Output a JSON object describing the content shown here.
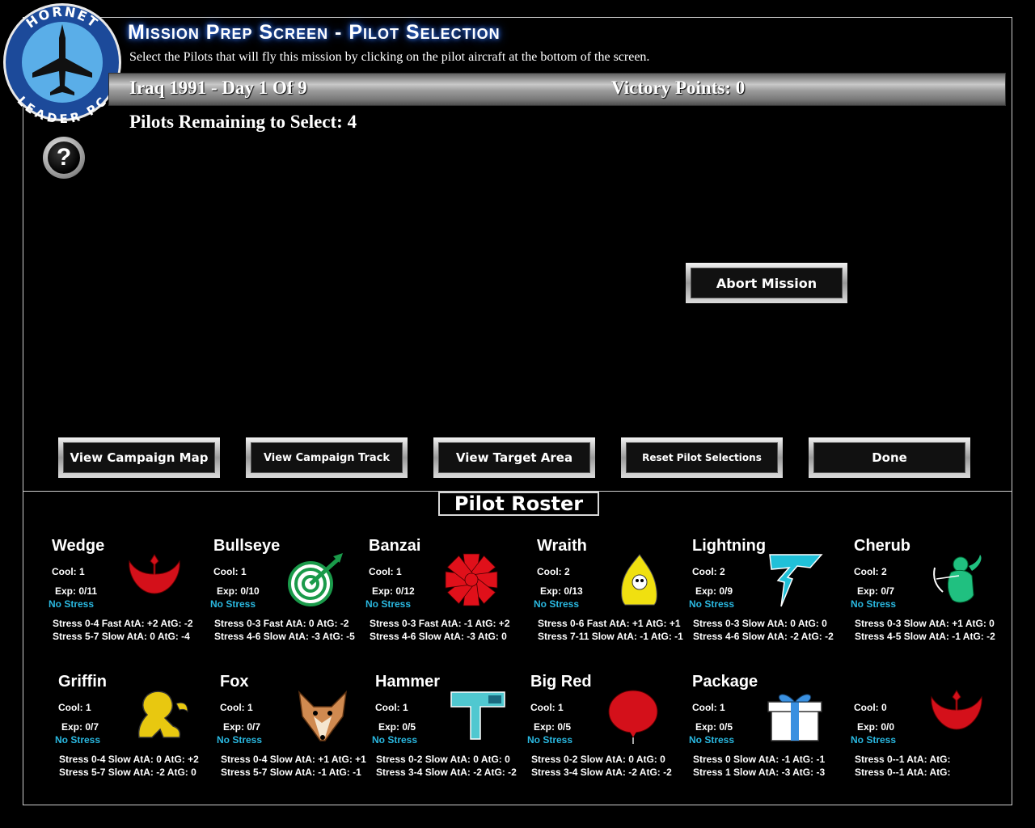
{
  "logo": {
    "top_text": "HORNET",
    "bottom_text": "LEADER PC"
  },
  "header": {
    "title": "Mission Prep Screen - Pilot Selection",
    "subtitle": "Select the Pilots that will fly this mission by clicking on the pilot aircraft at the bottom of the screen."
  },
  "banner": {
    "campaign": "Iraq 1991 - Day 1 Of 9",
    "victory_points": "Victory Points: 0"
  },
  "remaining": "Pilots Remaining to Select: 4",
  "help": {
    "label": "?"
  },
  "buttons": {
    "abort": "Abort Mission",
    "campaign_map": "View Campaign Map",
    "campaign_track": "View Campaign Track",
    "target_area": "View Target Area",
    "reset": "Reset Pilot Selections",
    "done": "Done"
  },
  "roster_title": "Pilot Roster",
  "pilots": [
    {
      "name": "Wedge",
      "cool": "Cool: 1",
      "exp": "Exp: 0/11",
      "stress": "No Stress",
      "line1": "Stress 0-4 Fast AtA: +2 AtG: -2",
      "line2": "Stress 5-7 Slow AtA: 0 AtG: -4",
      "icon": "red-anchor-icon",
      "color": "#d4101a"
    },
    {
      "name": "Bullseye",
      "cool": "Cool: 1",
      "exp": "Exp: 0/10",
      "stress": "No Stress",
      "line1": "Stress 0-3 Fast AtA: 0 AtG: -2",
      "line2": "Stress 4-6 Slow AtA: -3 AtG: -5",
      "icon": "bullseye-target-icon",
      "color": "#1a9a4a"
    },
    {
      "name": "Banzai",
      "cool": "Cool: 1",
      "exp": "Exp: 0/12",
      "stress": "No Stress",
      "line1": "Stress 0-3 Fast AtA: -1 AtG: +2",
      "line2": "Stress 4-6 Slow AtA: -3 AtG: 0",
      "icon": "rising-sun-burst-icon",
      "color": "#e0101a"
    },
    {
      "name": "Wraith",
      "cool": "Cool: 2",
      "exp": "Exp: 0/13",
      "stress": "No Stress",
      "line1": "Stress 0-6 Fast AtA: +1 AtG: +1",
      "line2": "Stress 7-11 Slow AtA: -1 AtG: -1",
      "icon": "yellow-ghost-icon",
      "color": "#f0e010"
    },
    {
      "name": "Lightning",
      "cool": "Cool: 2",
      "exp": "Exp: 0/9",
      "stress": "No Stress",
      "line1": "Stress 0-3 Slow AtA: 0 AtG: 0",
      "line2": "Stress 4-6 Slow AtA: -2 AtG: -2",
      "icon": "lightning-bolt-icon",
      "color": "#20c0d8"
    },
    {
      "name": "Cherub",
      "cool": "Cool: 2",
      "exp": "Exp: 0/7",
      "stress": "No Stress",
      "line1": "Stress 0-3 Slow AtA: +1 AtG: 0",
      "line2": "Stress 4-5 Slow AtA: -1 AtG: -2",
      "icon": "cherub-archer-icon",
      "color": "#20c080"
    },
    {
      "name": "Griffin",
      "cool": "Cool: 1",
      "exp": "Exp: 0/7",
      "stress": "No Stress",
      "line1": "Stress 0-4 Slow AtA: 0 AtG: +2",
      "line2": "Stress 5-7 Slow AtA: -2 AtG: 0",
      "icon": "griffin-lion-icon",
      "color": "#e8c810"
    },
    {
      "name": "Fox",
      "cool": "Cool: 1",
      "exp": "Exp: 0/7",
      "stress": "No Stress",
      "line1": "Stress 0-4 Slow AtA: +1 AtG: +1",
      "line2": "Stress 5-7 Slow AtA: -1 AtG: -1",
      "icon": "fox-head-icon",
      "color": "#d08a50"
    },
    {
      "name": "Hammer",
      "cool": "Cool: 1",
      "exp": "Exp: 0/5",
      "stress": "No Stress",
      "line1": "Stress 0-2 Slow AtA: 0 AtG: 0",
      "line2": "Stress 3-4 Slow AtA: -2 AtG: -2",
      "icon": "hammer-icon",
      "color": "#50c8d0"
    },
    {
      "name": "Big Red",
      "cool": "Cool: 1",
      "exp": "Exp: 0/5",
      "stress": "No Stress",
      "line1": "Stress 0-2 Slow AtA: 0 AtG: 0",
      "line2": "Stress 3-4 Slow AtA: -2 AtG: -2",
      "icon": "red-balloon-icon",
      "color": "#d4101a"
    },
    {
      "name": "Package",
      "cool": "Cool: 1",
      "exp": "Exp: 0/5",
      "stress": "No Stress",
      "line1": "Stress 0 Slow AtA: -1 AtG: -1",
      "line2": "Stress 1 Slow AtA: -3 AtG: -3",
      "icon": "gift-package-icon",
      "color": "#3a90e0"
    },
    {
      "name": "",
      "cool": "Cool: 0",
      "exp": "Exp: 0/0",
      "stress": "No Stress",
      "line1": "Stress 0--1  AtA:  AtG:",
      "line2": "Stress 0--1  AtA:  AtG:",
      "icon": "red-anchor-icon",
      "color": "#d4101a"
    }
  ]
}
